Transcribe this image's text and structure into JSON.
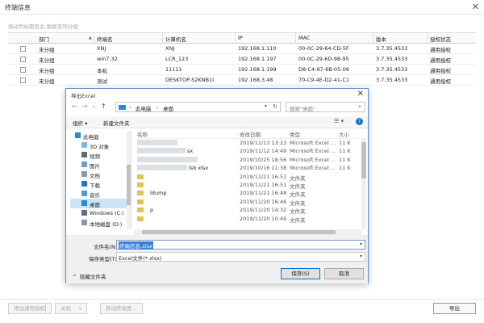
{
  "window": {
    "title": "终端信息",
    "close": "✕"
  },
  "group_hint": "拖动列标题至此,根据该列分组",
  "grid": {
    "headers": [
      "部门",
      "终端名",
      "计算机名",
      "IP",
      "MAC",
      "版本",
      "授权状态"
    ],
    "rows": [
      [
        "未分组",
        "XNJ",
        "XNJ",
        "192.168.1.110",
        "00-0C-29-64-CD-5F",
        "3.7.35.4533",
        "通用授权"
      ],
      [
        "未分组",
        "win7.32",
        "LCR_123",
        "192.168.1.197",
        "00-0C-29-6D-98-95",
        "3.7.35.4533",
        "通用授权"
      ],
      [
        "未分组",
        "本机",
        "11111",
        "192.168.1.199",
        "D8-C4-97-6B-05-06",
        "3.7.35.4533",
        "通用授权"
      ],
      [
        "未分组",
        "测试",
        "DESKTOP-S2KNB1I",
        "192.168.3.48",
        "70-C9-4E-D2-41-C1",
        "3.7.35.4533",
        "通用授权"
      ]
    ]
  },
  "dialog": {
    "title": "导出Excel",
    "address": {
      "crumb1": "此电脑",
      "sep": "›",
      "crumb2": "桌面"
    },
    "search_placeholder": "搜索\"桌面\"",
    "toolbar": {
      "organize": "组织 ▾",
      "new_folder": "新建文件夹"
    },
    "nav": [
      {
        "label": "此电脑",
        "icon": "pc-icon",
        "indent": 0
      },
      {
        "label": "3D 对象",
        "icon": "cube-icon",
        "indent": 1
      },
      {
        "label": "视频",
        "icon": "video-icon",
        "indent": 1
      },
      {
        "label": "图片",
        "icon": "picture-icon",
        "indent": 1
      },
      {
        "label": "文档",
        "icon": "document-icon",
        "indent": 1
      },
      {
        "label": "下载",
        "icon": "download-icon",
        "indent": 1
      },
      {
        "label": "音乐",
        "icon": "music-icon",
        "indent": 1
      },
      {
        "label": "桌面",
        "icon": "desktop-icon",
        "indent": 1,
        "selected": true
      },
      {
        "label": "Windows (C:)",
        "icon": "drive-icon",
        "indent": 1
      },
      {
        "label": "本地磁盘 (D:)",
        "icon": "drive-icon",
        "indent": 1
      }
    ],
    "file_columns": [
      "名称",
      "修改日期",
      "类型",
      "大小"
    ],
    "files": [
      {
        "name": "",
        "date": "2019/11/13 13:23",
        "type": "Microsoft Excel ...",
        "size": "11 K",
        "kind": "excel"
      },
      {
        "name": "sx",
        "date": "2019/11/12 14:49",
        "type": "Microsoft Excel ...",
        "size": "11 K",
        "kind": "excel"
      },
      {
        "name": "",
        "date": "2019/10/25 18:56",
        "type": "Microsoft Excel ...",
        "size": "11 K",
        "kind": "excel"
      },
      {
        "name": "lsb.xlsx",
        "date": "2019/10/16 11:38",
        "type": "Microsoft Excel ...",
        "size": "11 K",
        "kind": "excel"
      },
      {
        "name": "",
        "date": "2019/11/21 16:51",
        "type": "文件夹",
        "size": "",
        "kind": "folder"
      },
      {
        "name": "",
        "date": "2019/11/21 16:51",
        "type": "文件夹",
        "size": "",
        "kind": "folder"
      },
      {
        "name": "ldump",
        "date": "2019/11/21 16:48",
        "type": "文件夹",
        "size": "",
        "kind": "folder"
      },
      {
        "name": "",
        "date": "2019/11/20 16:46",
        "type": "文件夹",
        "size": "",
        "kind": "folder"
      },
      {
        "name": "p",
        "date": "2019/11/20 14:32",
        "type": "文件夹",
        "size": "",
        "kind": "folder"
      },
      {
        "name": "",
        "date": "2019/11/20 10:49",
        "type": "文件夹",
        "size": "",
        "kind": "folder"
      }
    ],
    "filename_label": "文件名(N):",
    "filename_value": "终端信息.xlsx",
    "filetype_label": "保存类型(T):",
    "filetype_value": "Excel文件(*.xlsx)",
    "hide_folders": "隐藏文件夹",
    "save": "保存(S)",
    "cancel": "取消"
  },
  "footer": {
    "add_license": "添加通用授权",
    "shutdown": "关机",
    "move_terminal": "移动终端至...",
    "export": "导出"
  }
}
